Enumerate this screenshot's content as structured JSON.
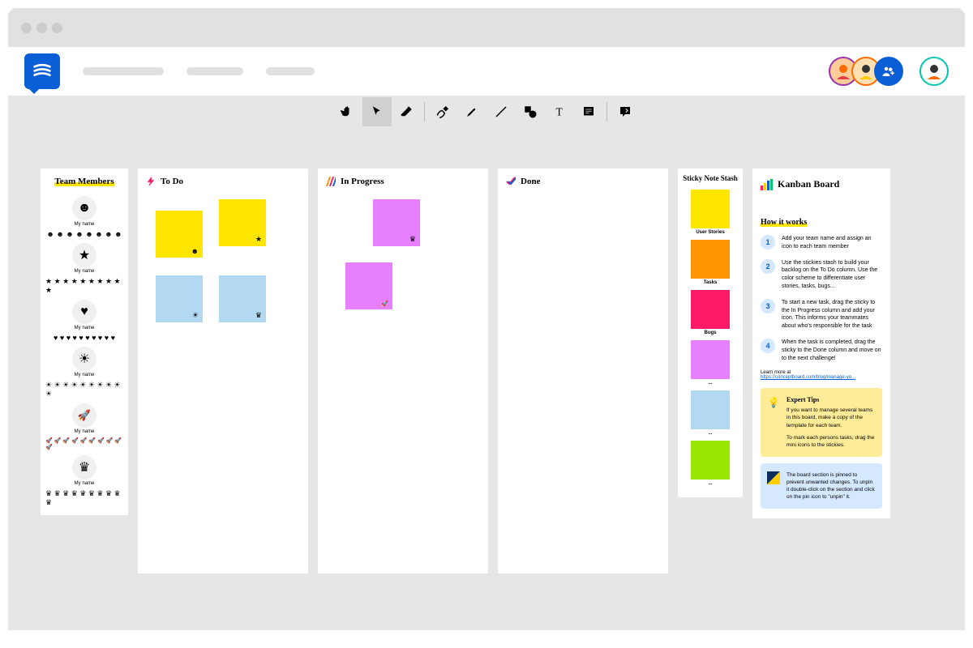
{
  "team": {
    "title": "Team Members",
    "members": [
      {
        "label": "My name",
        "glyph": "☻"
      },
      {
        "label": "My name",
        "glyph": "★"
      },
      {
        "label": "My name",
        "glyph": "♥"
      },
      {
        "label": "My name",
        "glyph": "☀"
      },
      {
        "label": "My name",
        "glyph": "🚀"
      },
      {
        "label": "My name",
        "glyph": "♛"
      }
    ]
  },
  "columns": {
    "todo": "To Do",
    "inprogress": "In Progress",
    "done": "Done"
  },
  "stash": {
    "title": "Sticky Note Stash",
    "labels": {
      "user": "User Stories",
      "tasks": "Tasks",
      "bugs": "Bugs",
      "d1": "...",
      "d2": "...",
      "d3": "..."
    }
  },
  "info": {
    "title": "Kanban Board",
    "how_title": "How it works",
    "steps": [
      "Add your team name and assign an icon to each team member",
      "Use the stickies stash to build your backlog on the To Do column. Use the color scheme to differentiate user stories, tasks, bugs...",
      "To start a new task, drag the sticky to the In Progress column and add your icon. This informs your teammates about who's responsible for the task",
      "When the task is completed, drag the sticky to the Done column and move on to the next challenge!"
    ],
    "learnmore_label": "Learn more at",
    "learnmore_link": "https://conceptboard.com/blog/manage-yo...",
    "tips_title": "Expert Tips",
    "tips_text1": "If you want to manage several teams in this board, make a copy of the template for each team.",
    "tips_text2": "To mark each persons tasks, drag the mini icons to the stickies.",
    "pin_text": "The board section is pinned to prevent unwanted changes. To unpin it double-click on the section and click on the pin icon to \"unpin\" it."
  }
}
